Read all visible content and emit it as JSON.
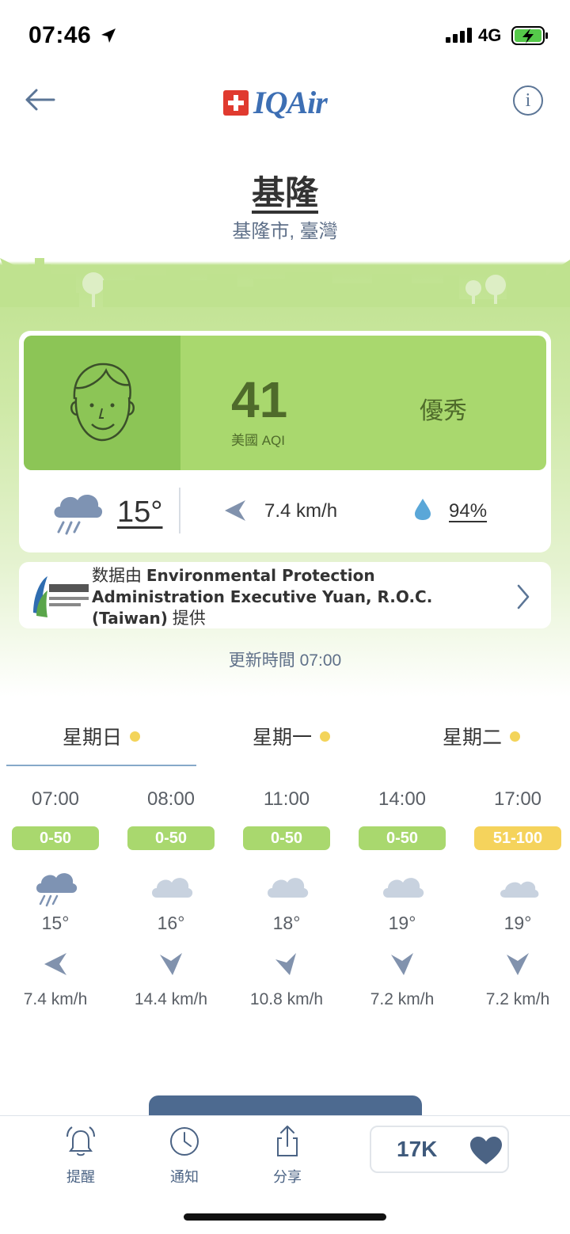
{
  "status_bar": {
    "time": "07:46",
    "network": "4G"
  },
  "header": {
    "brand": "IQAir",
    "info_glyph": "i"
  },
  "location": {
    "city": "基隆",
    "region": "基隆市, 臺灣"
  },
  "aqi": {
    "value": "41",
    "unit_label": "美國 AQI",
    "level": "優秀",
    "panel_color": "#a9d86e",
    "face_color": "#8cc556"
  },
  "weather": {
    "icon": "rain-cloud-icon",
    "temperature": "15°",
    "wind": "7.4 km/h",
    "humidity": "94%"
  },
  "source": {
    "prefix": "数据由",
    "name": "Environmental Protection Administration Executive Yuan, R.O.C. (Taiwan)",
    "suffix": "提供"
  },
  "updated": "更新時間 07:00",
  "day_tabs": [
    {
      "label": "星期日",
      "dot_color": "#f3d45a"
    },
    {
      "label": "星期一",
      "dot_color": "#f3d45a"
    },
    {
      "label": "星期二",
      "dot_color": "#f3d45a"
    }
  ],
  "forecast": [
    {
      "hour": "07:00",
      "aqi": "0-50",
      "badge_color": "#a9d86e",
      "icon": "rain-cloud-icon",
      "temp": "15°",
      "wind": "7.4 km/h"
    },
    {
      "hour": "08:00",
      "aqi": "0-50",
      "badge_color": "#a9d86e",
      "icon": "cloud-icon",
      "temp": "16°",
      "wind": "14.4 km/h"
    },
    {
      "hour": "11:00",
      "aqi": "0-50",
      "badge_color": "#a9d86e",
      "icon": "cloud-icon",
      "temp": "18°",
      "wind": "10.8 km/h"
    },
    {
      "hour": "14:00",
      "aqi": "0-50",
      "badge_color": "#a9d86e",
      "icon": "cloud-icon",
      "temp": "19°",
      "wind": "7.2 km/h"
    },
    {
      "hour": "17:00",
      "aqi": "51-100",
      "badge_color": "#f5d35c",
      "icon": "cloud-icon",
      "temp": "19°",
      "wind": "7.2 km/h"
    }
  ],
  "tabbar": {
    "alerts": "提醒",
    "notifications": "通知",
    "share": "分享",
    "likes": "17K"
  }
}
